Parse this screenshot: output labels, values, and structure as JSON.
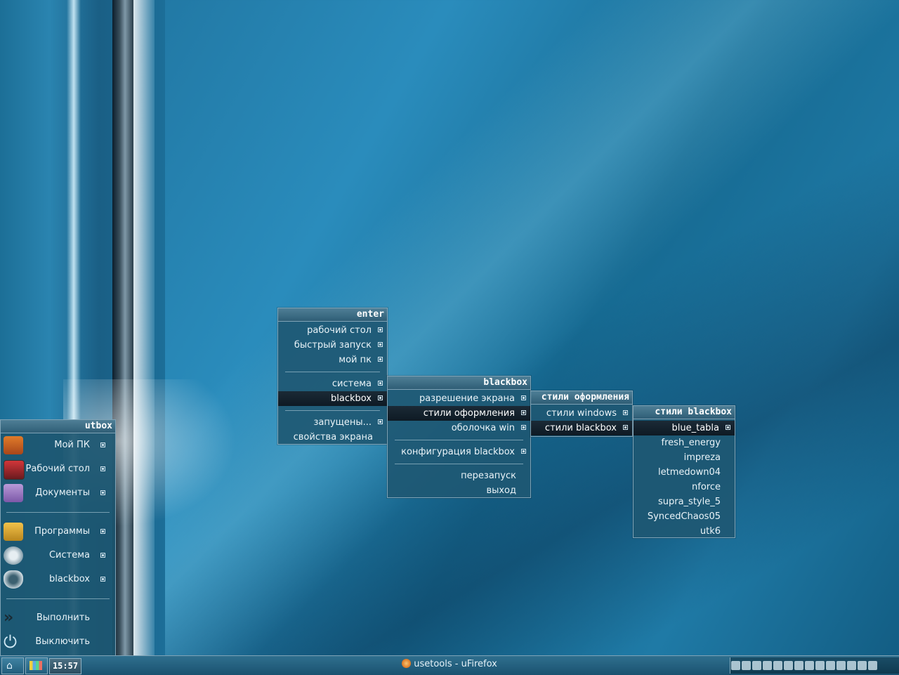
{
  "menus": {
    "enter": {
      "title": "enter",
      "items": [
        "рабочий стол",
        "быстрый запуск",
        "мой пк",
        "система",
        "blackbox",
        "запущены...",
        "свойства экрана"
      ]
    },
    "blackbox": {
      "title": "blackbox",
      "items": [
        "разрешение экрана",
        "стили оформления",
        "оболочка win",
        "конфигурация blackbox",
        "перезапуск",
        "выход"
      ]
    },
    "styles": {
      "title": "стили оформления",
      "items": [
        "стили windows",
        "стили blackbox"
      ]
    },
    "bbstyles": {
      "title": "стили blackbox",
      "items": [
        "blue_tabla",
        "fresh_energy",
        "impreza",
        "letmedown04",
        "nforce",
        "supra_style_5",
        "SyncedChaos05",
        "utk6"
      ]
    }
  },
  "sidebar": {
    "title": "utbox",
    "items": [
      "Мой ПК",
      "Рабочий стол",
      "Документы",
      "Программы",
      "Система",
      "blackbox",
      "Выполнить",
      "Выключить"
    ]
  },
  "taskbar": {
    "clock": "15:57",
    "task_title": "usetools - uFirefox"
  }
}
